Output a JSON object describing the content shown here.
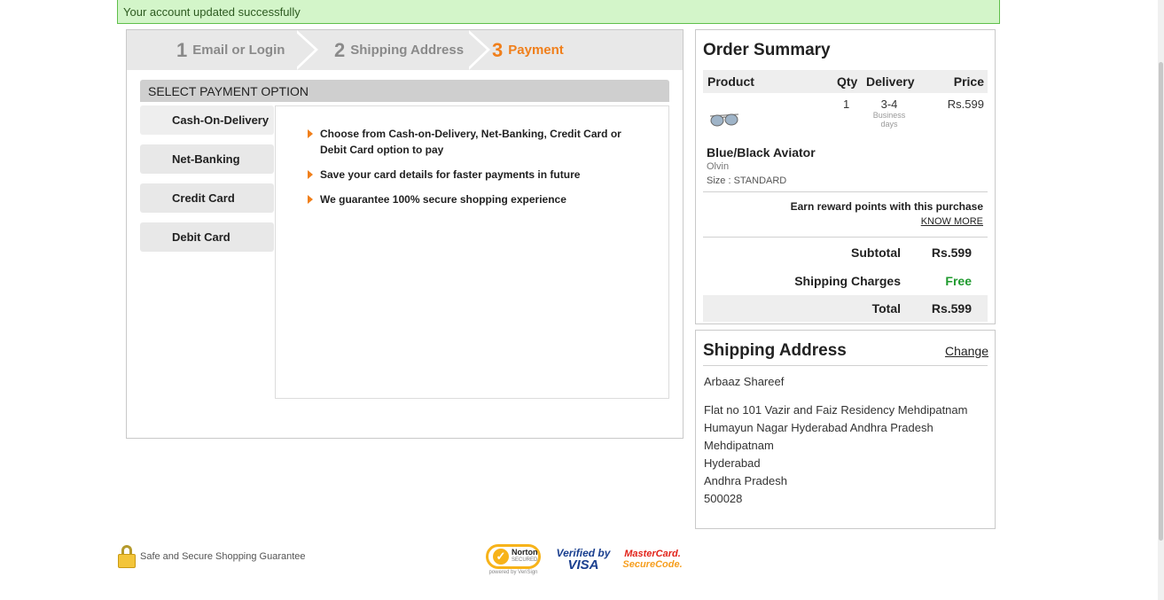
{
  "alert": {
    "message": "Your account updated successfully"
  },
  "steps": [
    {
      "number": "1",
      "label": "Email or Login"
    },
    {
      "number": "2",
      "label": "Shipping Address"
    },
    {
      "number": "3",
      "label": "Payment"
    }
  ],
  "payment": {
    "header": "SELECT PAYMENT OPTION",
    "options": [
      "Cash-On-Delivery",
      "Net-Banking",
      "Credit Card",
      "Debit Card"
    ],
    "bullets": [
      "Choose from Cash-on-Delivery, Net-Banking, Credit Card or Debit Card option to pay",
      "Save your card details for faster payments in future",
      "We guarantee 100% secure shopping experience"
    ]
  },
  "summary": {
    "title": "Order Summary",
    "columns": {
      "product": "Product",
      "qty": "Qty",
      "delivery": "Delivery",
      "price": "Price"
    },
    "item": {
      "qty": "1",
      "delivery_days": "3-4",
      "delivery_sub1": "Business",
      "delivery_sub2": "days",
      "price": "Rs.599",
      "name": "Blue/Black Aviator",
      "brand": "Olvin",
      "size": "Size : STANDARD"
    },
    "reward_text": "Earn reward points with this purchase",
    "know_more": "KNOW MORE",
    "subtotal_label": "Subtotal",
    "subtotal_value": "Rs.599",
    "shipping_label": "Shipping Charges",
    "shipping_value": "Free",
    "total_label": "Total",
    "total_value": "Rs.599",
    "colors": {
      "free": "#1f9a2e",
      "step_active": "#f07f1b"
    }
  },
  "shipping": {
    "title": "Shipping Address",
    "change": "Change",
    "name": "Arbaaz Shareef",
    "lines": [
      "Flat no 101 Vazir and Faiz Residency Mehdipatnam",
      "Humayun Nagar Hyderabad Andhra Pradesh",
      "Mehdipatnam",
      "Hyderabad",
      "Andhra Pradesh",
      "500028"
    ]
  },
  "footer": {
    "secure_text": "Safe and Secure Shopping Guarantee",
    "norton": {
      "name": "Norton",
      "secured": "SECURED",
      "powered": "powered by VeriSign"
    },
    "visa": {
      "line1": "Verified by",
      "line2": "VISA"
    },
    "mastercard": {
      "line1": "MasterCard.",
      "line2": "SecureCode."
    }
  }
}
